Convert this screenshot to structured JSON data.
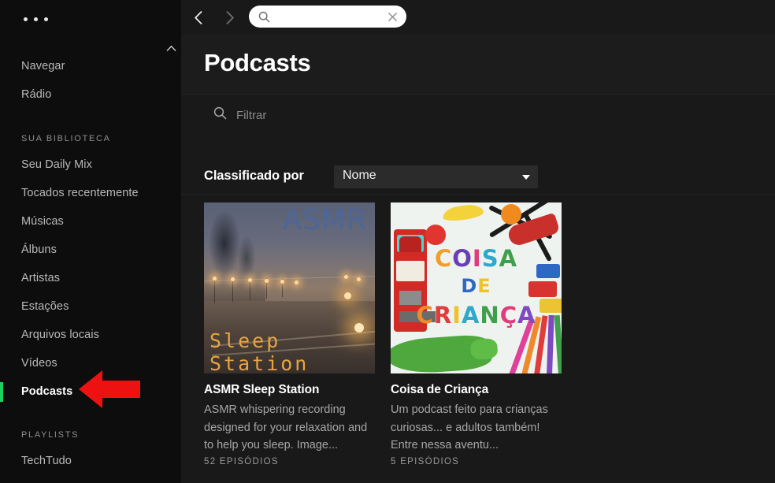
{
  "sidebar": {
    "overflow_menu": "...",
    "top_items": [
      {
        "label": "Navegar"
      },
      {
        "label": "Rádio"
      }
    ],
    "library_heading": "SUA BIBLIOTECA",
    "library_items": [
      {
        "label": "Seu Daily Mix",
        "active": false
      },
      {
        "label": "Tocados recentemente",
        "active": false
      },
      {
        "label": "Músicas",
        "active": false
      },
      {
        "label": "Álbuns",
        "active": false
      },
      {
        "label": "Artistas",
        "active": false
      },
      {
        "label": "Estações",
        "active": false
      },
      {
        "label": "Arquivos locais",
        "active": false
      },
      {
        "label": "Vídeos",
        "active": false
      },
      {
        "label": "Podcasts",
        "active": true
      }
    ],
    "playlists_heading": "PLAYLISTS",
    "playlist_items": [
      {
        "label": "TechTudo"
      }
    ],
    "active_indicator_color": "#19d25f"
  },
  "topbar": {
    "back_icon": "chevron-left-icon",
    "forward_icon": "chevron-right-icon",
    "search": {
      "icon": "search-icon",
      "value": "",
      "placeholder": "",
      "clear_icon": "close-icon"
    }
  },
  "header": {
    "title": "Podcasts"
  },
  "filter": {
    "icon": "search-icon",
    "value": "",
    "placeholder": "Filtrar"
  },
  "sort": {
    "label": "Classificado por",
    "value": "Nome",
    "caret_icon": "chevron-down-icon"
  },
  "podcasts": [
    {
      "title": "ASMR Sleep Station",
      "description": "ASMR whispering recording designed for your relaxation and to help you sleep. Image...",
      "episodes": "52 EPISÓDIOS",
      "art": {
        "type": "photo-foggy-night-street",
        "text_top": "ASMR",
        "text_bottom": "Sleep Station",
        "text_top_color": "#4d6699",
        "text_bottom_color": "#e9a440"
      }
    },
    {
      "title": "Coisa de Criança",
      "description": "Um podcast feito para crianças curiosas... e adultos também! Entre nessa aventu...",
      "episodes": "5 EPISÓDIOS",
      "art": {
        "type": "photo-toy-letters",
        "line1": "COISA",
        "line2": "DE",
        "line3": "CRIANÇA",
        "line1_colors": [
          "#f0a028",
          "#6a3fb5",
          "#e03c7c",
          "#2fa8c9",
          "#3f9f4a"
        ],
        "line2_colors": [
          "#2f68c4",
          "#f0c22a"
        ],
        "line3_colors": [
          "#ef8a2b",
          "#e03c3c",
          "#f0c22a",
          "#2fa8c9",
          "#3f9f4a",
          "#e03c7c",
          "#7f4ac0"
        ]
      }
    }
  ],
  "annotation": {
    "arrow": "red-left-arrow",
    "color": "#ee1111",
    "points_to": "Podcasts"
  },
  "scrollbar": {
    "up_arrow_icon": "chevron-up-icon",
    "thumb_color": "#666666"
  }
}
